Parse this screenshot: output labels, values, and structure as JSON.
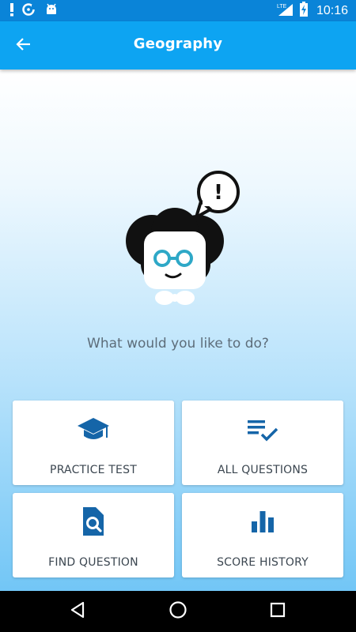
{
  "status_bar": {
    "time": "10:16",
    "network": "LTE",
    "left_icons": [
      "alert-icon",
      "sync-icon",
      "android-icon"
    ],
    "right_icons": [
      "signal-icon",
      "battery-charging-icon"
    ]
  },
  "app_bar": {
    "title": "Geography",
    "back_icon": "arrow-left-icon"
  },
  "main": {
    "mascot_bubble_text": "!",
    "prompt": "What would you like to do?",
    "actions": [
      {
        "label": "PRACTICE TEST",
        "icon": "graduation-cap-icon"
      },
      {
        "label": "ALL QUESTIONS",
        "icon": "list-check-icon"
      },
      {
        "label": "FIND QUESTION",
        "icon": "file-search-icon"
      },
      {
        "label": "SCORE HISTORY",
        "icon": "bar-chart-icon"
      }
    ]
  },
  "nav_bar": {
    "icons": [
      "back-triangle-icon",
      "home-circle-icon",
      "recents-square-icon"
    ]
  },
  "colors": {
    "status_bar": "#0a84d8",
    "app_bar": "#0da4f2",
    "icon_blue": "#1565a8",
    "mascot_glasses": "#2ea8c7",
    "text_gray": "#5d6d7a"
  }
}
